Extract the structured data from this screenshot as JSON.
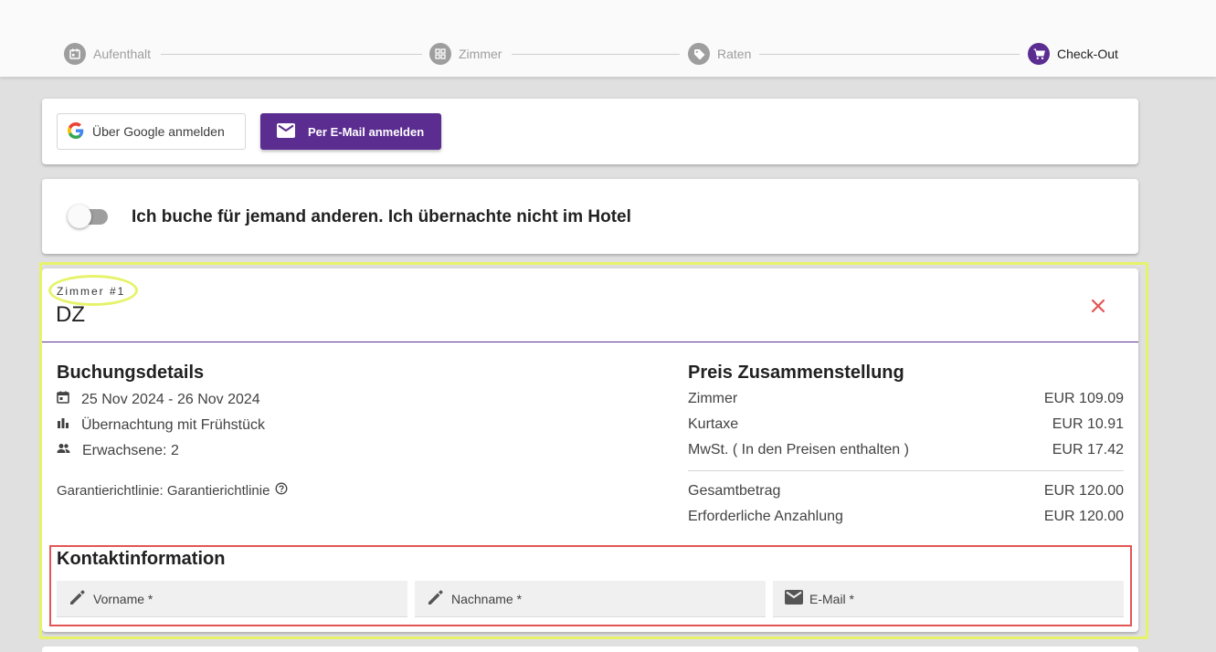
{
  "stepper": {
    "steps": [
      {
        "label": "Aufenthalt",
        "icon": "calendar-icon",
        "active": false
      },
      {
        "label": "Zimmer",
        "icon": "grid-icon",
        "active": false
      },
      {
        "label": "Raten",
        "icon": "tag-icon",
        "active": false
      },
      {
        "label": "Check-Out",
        "icon": "cart-icon",
        "active": true
      }
    ]
  },
  "login": {
    "google_label": "Über Google anmelden",
    "email_label": "Per E-Mail anmelden"
  },
  "booking_for_other": {
    "label": "Ich buche für jemand anderen. Ich übernachte nicht im Hotel",
    "enabled": false
  },
  "room": {
    "number_label": "Zimmer #1",
    "name": "DZ",
    "booking_details_title": "Buchungsdetails",
    "dates": "25 Nov 2024 - 26 Nov 2024",
    "board": "Übernachtung mit Frühstück",
    "guests": "Erwachsene: 2",
    "policy": "Garantierichtlinie: Garantierichtlinie",
    "price_title": "Preis Zusammenstellung",
    "prices": [
      {
        "label": "Zimmer",
        "value": "EUR 109.09"
      },
      {
        "label": "Kurtaxe",
        "value": "EUR 10.91"
      },
      {
        "label": "MwSt. ( In den Preisen enthalten )",
        "value": "EUR 17.42"
      }
    ],
    "totals": [
      {
        "label": "Gesamtbetrag",
        "value": "EUR 120.00"
      },
      {
        "label": "Erforderliche Anzahlung",
        "value": "EUR 120.00"
      }
    ],
    "contact_title": "Kontaktinformation",
    "fields": {
      "first_name": "Vorname *",
      "last_name": "Nachname *",
      "email": "E-Mail *"
    }
  },
  "colors": {
    "accent": "#5b2d91",
    "close": "#e35555",
    "highlight_yellow": "#e6f36a",
    "highlight_red": "#e35555"
  }
}
